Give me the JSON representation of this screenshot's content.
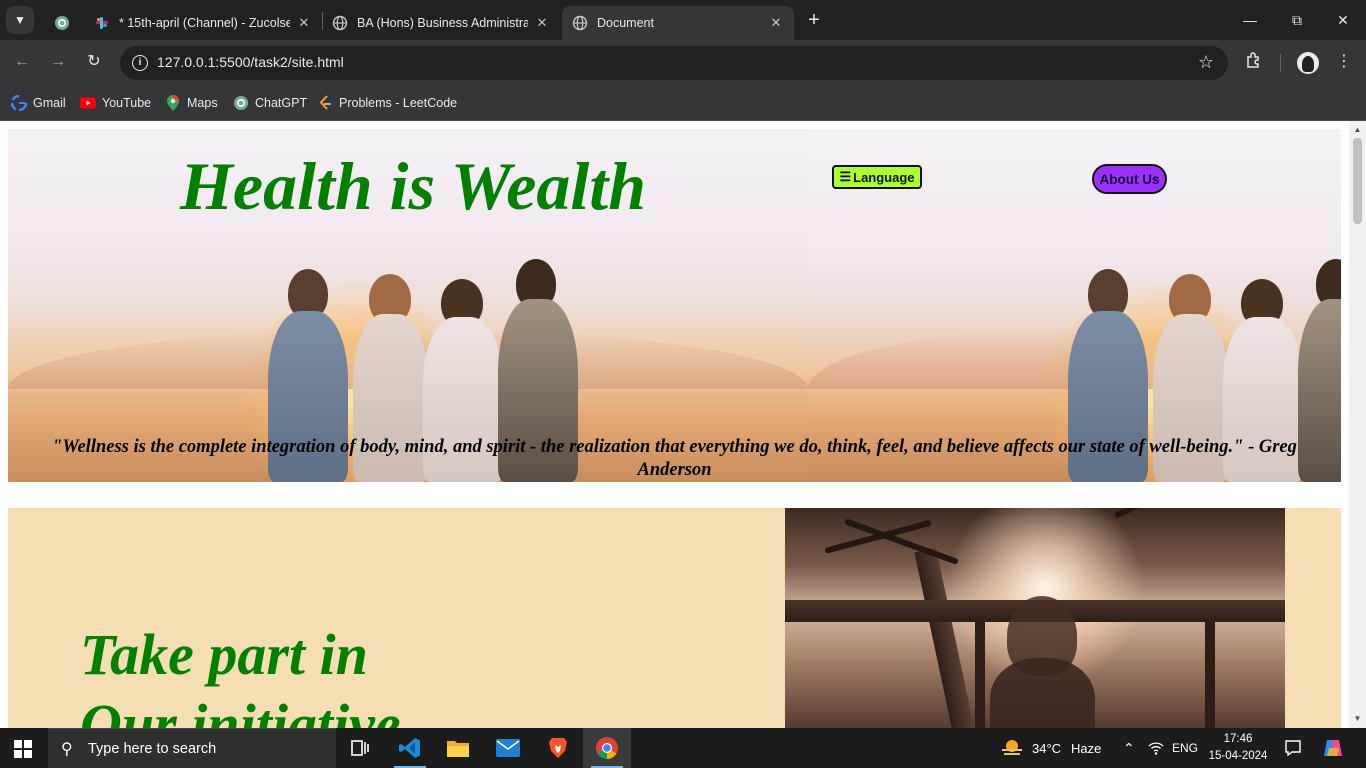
{
  "browser": {
    "tabs": [
      {
        "title": "",
        "favicon": "chatgpt-icon"
      },
      {
        "title": "* 15th-april (Channel) - Zucolse",
        "favicon": "slack-icon"
      },
      {
        "title": "BA (Hons) Business Administrati",
        "favicon": "globe-icon"
      },
      {
        "title": "Document",
        "favicon": "globe-icon",
        "active": true
      }
    ],
    "url": "127.0.0.1:5500/task2/site.html",
    "bookmarks": [
      {
        "label": "Gmail",
        "icon": "google-icon"
      },
      {
        "label": "YouTube",
        "icon": "youtube-icon"
      },
      {
        "label": "Maps",
        "icon": "maps-icon"
      },
      {
        "label": "ChatGPT",
        "icon": "chatgpt-icon"
      },
      {
        "label": "Problems - LeetCode",
        "icon": "leetcode-icon"
      }
    ]
  },
  "page": {
    "hero": {
      "title": "Health is Wealth",
      "language_button": "Language",
      "about_button": "About Us",
      "quote": "\"Wellness is the complete integration of body, mind, and spirit - the realization that everything we do, think, feel, and believe affects our state of well-being.\" - Greg Anderson"
    },
    "initiative": {
      "line1": "Take part in",
      "line2": "Our initiative"
    }
  },
  "taskbar": {
    "search_placeholder": "Type here to search",
    "weather": {
      "temp": "34°C",
      "condition": "Haze"
    },
    "language": "ENG",
    "time": "17:46",
    "date": "15-04-2024"
  },
  "colors": {
    "title_green": "#008000",
    "language_button": "#adff2f",
    "about_button": "#9b30ff",
    "initiative_bg": "#f5deb3"
  }
}
